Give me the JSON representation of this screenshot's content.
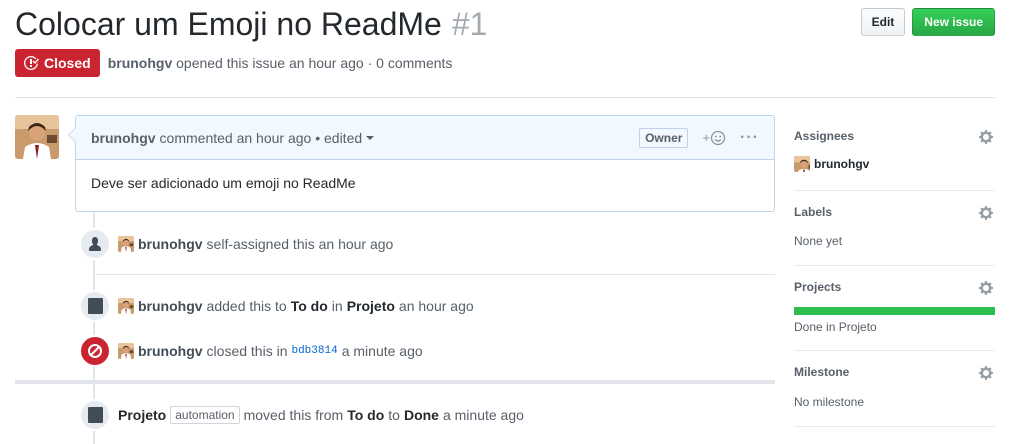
{
  "issue": {
    "title": "Colocar um Emoji no ReadMe",
    "number": "#1",
    "state": "Closed",
    "author": "brunohgv",
    "meta_suffix": "opened this issue an hour ago · 0 comments"
  },
  "header_actions": {
    "edit_label": "Edit",
    "new_issue_label": "New issue"
  },
  "comment": {
    "author": "brunohgv",
    "meta": "commented an hour ago • edited",
    "owner_badge": "Owner",
    "body": "Deve ser adicionado um emoji no ReadMe",
    "react_plus": "+"
  },
  "timeline": [
    {
      "icon": "person-icon",
      "user": "brunohgv",
      "text": "self-assigned this an hour ago"
    },
    {
      "icon": "project-icon",
      "user": "brunohgv",
      "pre": "added this to",
      "column": "To do",
      "mid": "in",
      "project": "Projeto",
      "post": "an hour ago"
    },
    {
      "icon": "circle-slash-icon",
      "user": "brunohgv",
      "pre": "closed this in",
      "sha": "bdb3814",
      "post": "a minute ago"
    },
    {
      "icon": "project-icon",
      "project": "Projeto",
      "tag": "automation",
      "pre": "moved this from",
      "from": "To do",
      "mid": "to",
      "to": "Done",
      "post": "a minute ago"
    }
  ],
  "sidebar": {
    "assignees": {
      "title": "Assignees",
      "user": "brunohgv"
    },
    "labels": {
      "title": "Labels",
      "value": "None yet"
    },
    "projects": {
      "title": "Projects",
      "value": "Done in Projeto",
      "progress": 1.0
    },
    "milestone": {
      "title": "Milestone",
      "value": "No milestone"
    }
  },
  "colors": {
    "closed": "#cb2431",
    "new_issue": "#28a745",
    "link": "#0366d6",
    "progress": "#2cbe4e"
  }
}
